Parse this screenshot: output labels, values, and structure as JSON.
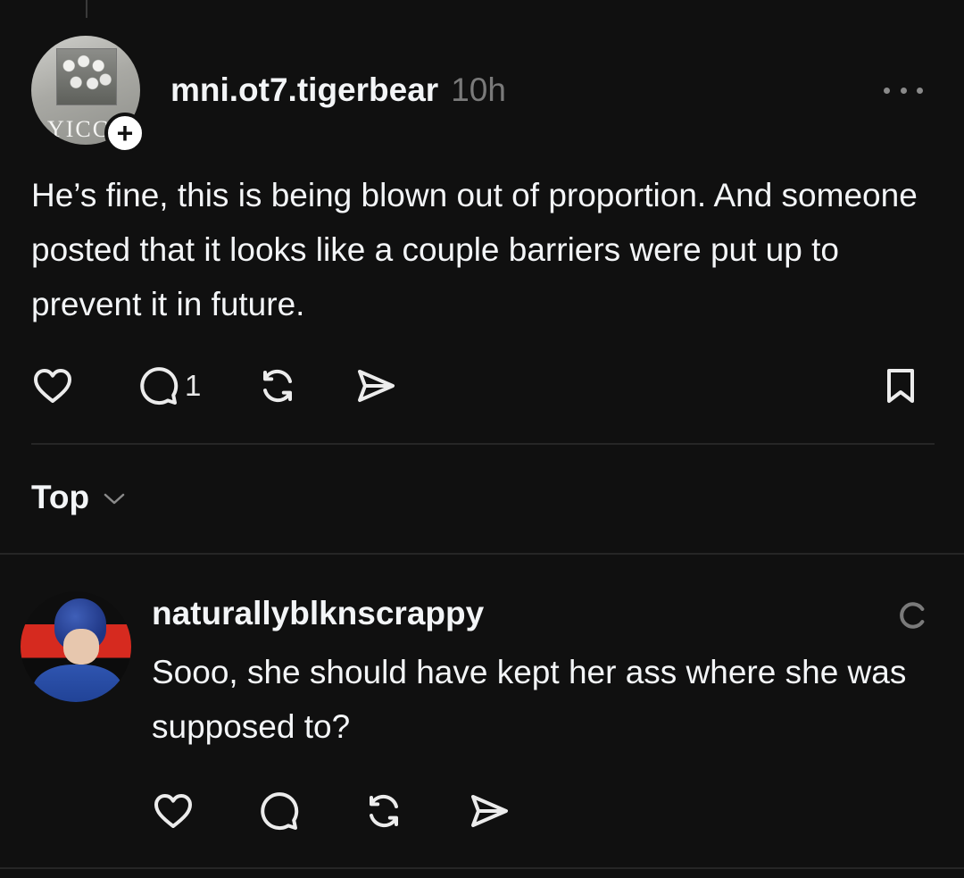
{
  "post": {
    "username": "mni.ot7.tigerbear",
    "time": "10h",
    "avatar_logo_text": "YICC",
    "follow_badge": "+",
    "body": "He’s fine, this is being blown out of proportion. And someone posted that it looks like a couple barriers were put up to prevent it in future.",
    "actions": {
      "like_icon": "heart-icon",
      "reply_icon": "comment-icon",
      "reply_count": "1",
      "repost_icon": "repost-icon",
      "share_icon": "send-icon",
      "save_icon": "bookmark-icon"
    }
  },
  "sort": {
    "label": "Top",
    "icon": "chevron-down-icon"
  },
  "reply": {
    "username": "naturallyblknscrappy",
    "status_icon": "loading-spinner-icon",
    "body": "Sooo, she should have kept her ass where she was supposed to?",
    "actions": {
      "like_icon": "heart-icon",
      "reply_icon": "comment-icon",
      "repost_icon": "repost-icon",
      "share_icon": "send-icon"
    }
  },
  "colors": {
    "background": "#101010",
    "text_primary": "#f3f5f7",
    "text_secondary": "#7a7a7a",
    "divider": "#262626"
  }
}
